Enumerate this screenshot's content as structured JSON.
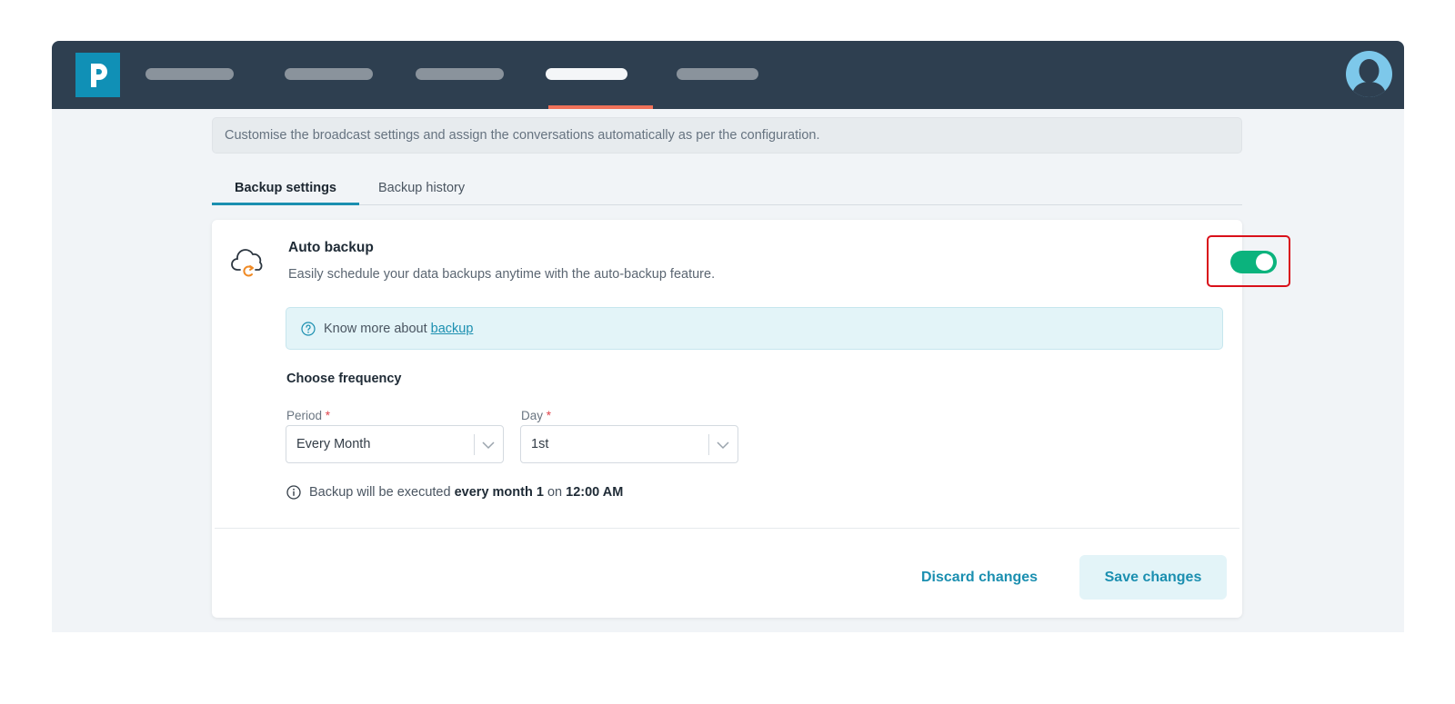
{
  "header": {
    "logo_icon": "p-logo-icon",
    "nav_items": [
      "",
      "",
      "",
      "",
      ""
    ],
    "active_nav_index": 3,
    "avatar_icon": "user-avatar-icon"
  },
  "info_banner": {
    "text": "Customise the broadcast settings and assign the conversations automatically as per the configuration."
  },
  "tabs": [
    {
      "label": "Backup settings",
      "active": true
    },
    {
      "label": "Backup history",
      "active": false
    }
  ],
  "auto_backup": {
    "icon": "cloud-sync-icon",
    "title": "Auto backup",
    "description": "Easily schedule your data backups anytime with the auto-backup feature.",
    "enabled": true
  },
  "learn_more": {
    "icon": "question-circle-icon",
    "text": "Know more about",
    "link_text": "backup"
  },
  "frequency": {
    "title": "Choose frequency",
    "period": {
      "label": "Period",
      "required_mark": "*",
      "value": "Every Month"
    },
    "day": {
      "label": "Day",
      "required_mark": "*",
      "value": "1st"
    }
  },
  "schedule_note": {
    "icon": "info-circle-icon",
    "prefix": "Backup will be executed",
    "frequency_text": "every month 1",
    "middle": "on",
    "time": "12:00 AM"
  },
  "actions": {
    "discard_label": "Discard changes",
    "save_label": "Save changes"
  },
  "colors": {
    "topbar": "#2e3f50",
    "accent": "#1b8fb0",
    "toggle_on": "#0bb37d",
    "nav_underline": "#f0725a",
    "highlight_box": "#d9101a"
  }
}
